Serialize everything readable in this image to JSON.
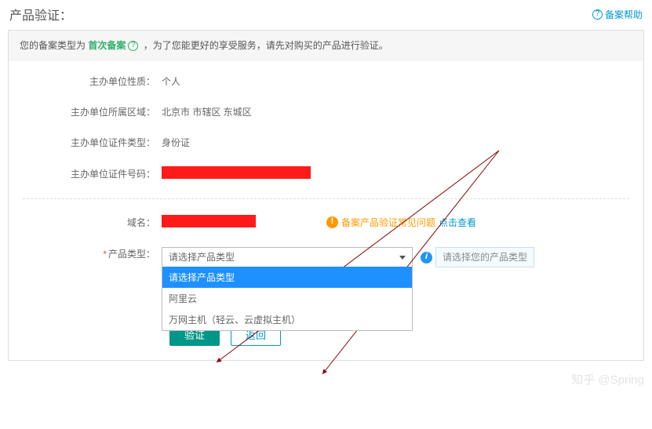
{
  "header": {
    "title": "产品验证：",
    "help": "备案帮助"
  },
  "notice": {
    "pre": "您的备案类型为 ",
    "first": "首次备案",
    "post": " ，为了您能更好的享受服务，请先对购买的产品进行验证。"
  },
  "fields": {
    "nature": {
      "label": "主办单位性质：",
      "value": "个人"
    },
    "region": {
      "label": "主办单位所属区域：",
      "value": "北京市 市辖区 东城区"
    },
    "idtype": {
      "label": "主办单位证件类型：",
      "value": "身份证"
    },
    "idno": {
      "label": "主办单位证件号码："
    },
    "domain": {
      "label": "域名："
    },
    "ptype": {
      "label": "产品类型："
    }
  },
  "faq": {
    "text": "备案产品验证常见问题 ",
    "click": "点击查看"
  },
  "select": {
    "selected": "请选择产品类型",
    "options": [
      "请选择产品类型",
      "阿里云",
      "万网主机（轻云、云虚拟主机）"
    ],
    "tip": "请选择您的产品类型"
  },
  "buttons": {
    "verify": "验证",
    "back": "返回"
  },
  "watermark": "知乎 @Spring"
}
